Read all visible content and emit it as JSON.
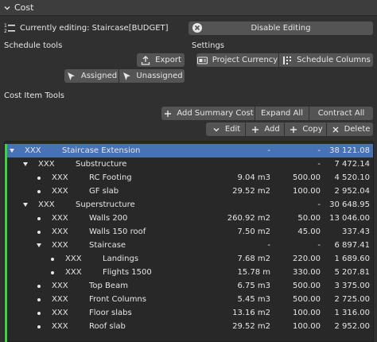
{
  "panel": {
    "title": "Cost"
  },
  "editing": {
    "status_text": "Currently editing: Staircase[BUDGET]",
    "disable_label": "Disable Editing"
  },
  "schedule_tools": {
    "heading": "Schedule tools",
    "export_label": "Export",
    "assigned_label": "Assigned",
    "unassigned_label": "Unassigned"
  },
  "settings": {
    "heading": "Settings",
    "project_currency_label": "Project Currency",
    "schedule_columns_label": "Schedule Columns"
  },
  "cost_item_tools": {
    "heading": "Cost Item Tools",
    "add_summary_label": "Add Summary Cost",
    "expand_all_label": "Expand All",
    "contract_all_label": "Contract All",
    "edit_label": "Edit",
    "add_label": "Add",
    "copy_label": "Copy",
    "delete_label": "Delete"
  },
  "cost_items": [
    {
      "marker": "expanded",
      "id": "XXX",
      "name": "Staircase Extension",
      "quantity": "-",
      "rate": "-",
      "total": "38 121.08",
      "selected": true
    },
    {
      "marker": "expanded",
      "id": "XXX",
      "name": "Substructure",
      "quantity": "",
      "rate": "-",
      "total": "7 472.14"
    },
    {
      "marker": "leaf",
      "id": "XXX",
      "name": "RC Footing",
      "quantity": "9.04 m3",
      "rate": "500.00",
      "total": "4 520.10"
    },
    {
      "marker": "leaf",
      "id": "XXX",
      "name": "GF slab",
      "quantity": "29.52 m2",
      "rate": "100.00",
      "total": "2 952.04"
    },
    {
      "marker": "expanded",
      "id": "XXX",
      "name": "Superstructure",
      "quantity": "",
      "rate": "-",
      "total": "30 648.95"
    },
    {
      "marker": "leaf",
      "id": "XXX",
      "name": "Walls 200",
      "quantity": "260.92 m2",
      "rate": "50.00",
      "total": "13 046.00"
    },
    {
      "marker": "leaf",
      "id": "XXX",
      "name": "Walls 150 roof",
      "quantity": "7.50 m2",
      "rate": "45.00",
      "total": "337.43"
    },
    {
      "marker": "expanded",
      "id": "XXX",
      "name": "Staircase",
      "quantity": "-",
      "rate": "-",
      "total": "6 897.41"
    },
    {
      "marker": "leaf",
      "id": "XXX",
      "name": "Landings",
      "quantity": "7.68 m2",
      "rate": "220.00",
      "total": "1 689.60"
    },
    {
      "marker": "leaf",
      "id": "XXX",
      "name": "Flights 1500",
      "quantity": "15.78 m",
      "rate": "330.00",
      "total": "5 207.81"
    },
    {
      "marker": "leaf",
      "id": "XXX",
      "name": "Top Beam",
      "quantity": "6.75 m3",
      "rate": "500.00",
      "total": "3 375.00"
    },
    {
      "marker": "leaf",
      "id": "XXX",
      "name": "Front Columns",
      "quantity": "5.45 m3",
      "rate": "500.00",
      "total": "2 725.00"
    },
    {
      "marker": "leaf",
      "id": "XXX",
      "name": "Floor slabs",
      "quantity": "13.16 m2",
      "rate": "100.00",
      "total": "1 316.00"
    },
    {
      "marker": "leaf",
      "id": "XXX",
      "name": "Roof slab",
      "quantity": "29.52 m2",
      "rate": "100.00",
      "total": "2 952.00"
    }
  ],
  "colors": {
    "selection": "#4772b3",
    "progress_indicator": "#3dd53d",
    "button": "#545454",
    "background": "#303030"
  }
}
